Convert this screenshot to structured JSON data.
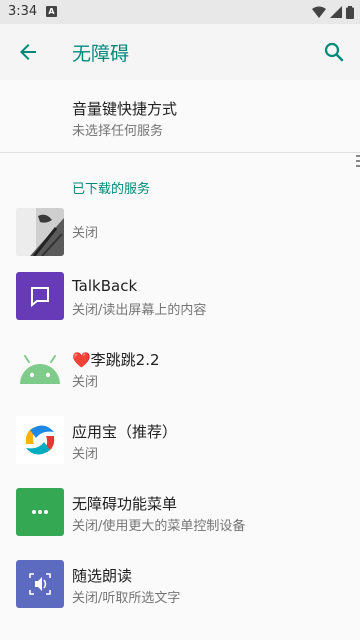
{
  "status": {
    "time": "3:34",
    "notif_letter": "A"
  },
  "header": {
    "title": "无障碍",
    "back_icon": "arrow-back-icon",
    "search_icon": "search-icon"
  },
  "shortcut": {
    "title": "音量键快捷方式",
    "subtitle": "未选择任何服务"
  },
  "section": {
    "title": "已下载的服务"
  },
  "services": [
    {
      "name": "",
      "status": "关闭",
      "icon": "photo-thumbnail-icon"
    },
    {
      "name": "TalkBack",
      "status": "关闭/读出屏幕上的内容",
      "icon": "talkback-icon"
    },
    {
      "name": "❤️李跳跳2.2",
      "status": "关闭",
      "icon": "android-robot-icon"
    },
    {
      "name": "应用宝（推荐）",
      "status": "关闭",
      "icon": "yingyongbao-icon"
    },
    {
      "name": "无障碍功能菜单",
      "status": "关闭/使用更大的菜单控制设备",
      "icon": "accessibility-menu-icon"
    },
    {
      "name": "随选朗读",
      "status": "关闭/听取所选文字",
      "icon": "select-to-speak-icon"
    }
  ],
  "colors": {
    "accent": "#00897b",
    "talkback": "#673ab7",
    "menu": "#34a853",
    "speak": "#5c6bc0",
    "android": "#7ecb8a"
  }
}
